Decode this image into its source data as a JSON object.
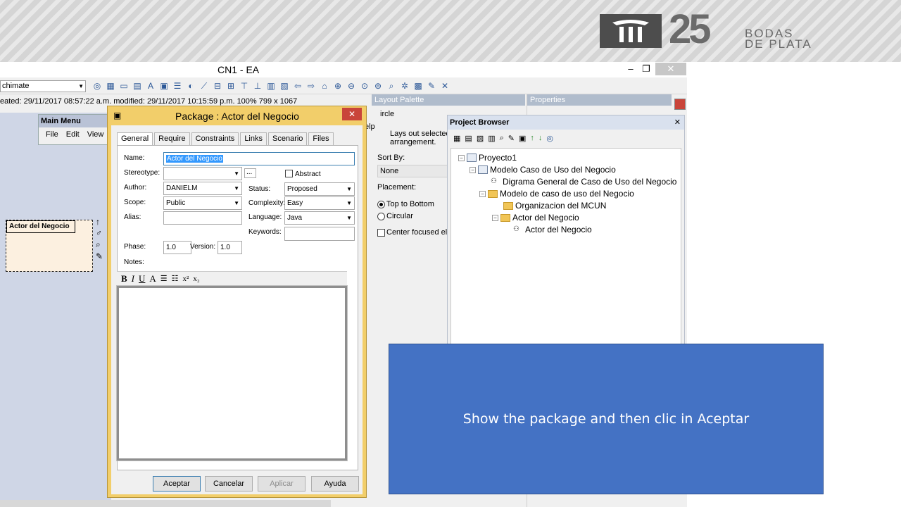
{
  "banner": {
    "logo_number": "25",
    "logo_line1": "BODAS",
    "logo_line2": "DE PLATA"
  },
  "app": {
    "title": "CN1 - EA",
    "close_glyph": "✕",
    "minimize_glyph": "–",
    "restore_glyph": "❐",
    "combo_value": "chimate",
    "status_line": "eated: 29/11/2017 08:57:22 a.m.  modified: 29/11/2017 10:15:59 p.m.   100%   799 x 1067"
  },
  "main_menu": {
    "title": "Main Menu",
    "items": [
      "File",
      "Edit",
      "View"
    ]
  },
  "diagram": {
    "element_label": "Actor del Negocio"
  },
  "layout_palette": {
    "title": "Layout Palette",
    "first_item": "ircle",
    "help_fragment": "elp",
    "description_line1": "Lays out selected",
    "description_line2": "arrangement.",
    "sort_by_label": "Sort By:",
    "sort_by_value": "None",
    "placement_label": "Placement:",
    "option_top_bottom": "Top to Bottom",
    "option_circular": "Circular",
    "center_focused": "Center focused ele"
  },
  "properties": {
    "title": "Properties"
  },
  "project_browser": {
    "title": "Project Browser",
    "nodes": [
      "Proyecto1",
      "Modelo Caso de Uso del Negocio",
      "Digrama General de Caso de Uso del Negocio",
      "Modelo de caso de uso del Negocio",
      "Organizacion del MCUN",
      "Actor del Negocio",
      "Actor del Negocio"
    ]
  },
  "dialog": {
    "title": "Package : Actor del Negocio",
    "tabs": [
      "General",
      "Require",
      "Constraints",
      "Links",
      "Scenario",
      "Files"
    ],
    "name_label": "Name:",
    "name_value": "Actor del Negocio",
    "stereotype_label": "Stereotype:",
    "stereotype_value": "",
    "ellipsis": "...",
    "abstract_label": "Abstract",
    "author_label": "Author:",
    "author_value": "DANIELM",
    "status_label": "Status:",
    "status_value": "Proposed",
    "scope_label": "Scope:",
    "scope_value": "Public",
    "complexity_label": "Complexity:",
    "complexity_value": "Easy",
    "alias_label": "Alias:",
    "alias_value": "",
    "language_label": "Language:",
    "language_value": "Java",
    "keywords_label": "Keywords:",
    "keywords_value": "",
    "phase_label": "Phase:",
    "phase_value": "1.0",
    "version_label": "Version:",
    "version_value": "1.0",
    "notes_label": "Notes:",
    "buttons": {
      "ok": "Aceptar",
      "cancel": "Cancelar",
      "apply": "Aplicar",
      "help": "Ayuda"
    }
  },
  "callout": {
    "text": "Show the package and then clic in Aceptar"
  },
  "colors": {
    "callout_bg": "#4472c4",
    "dialog_frame": "#f2ce6a",
    "selection": "#3399ff"
  }
}
